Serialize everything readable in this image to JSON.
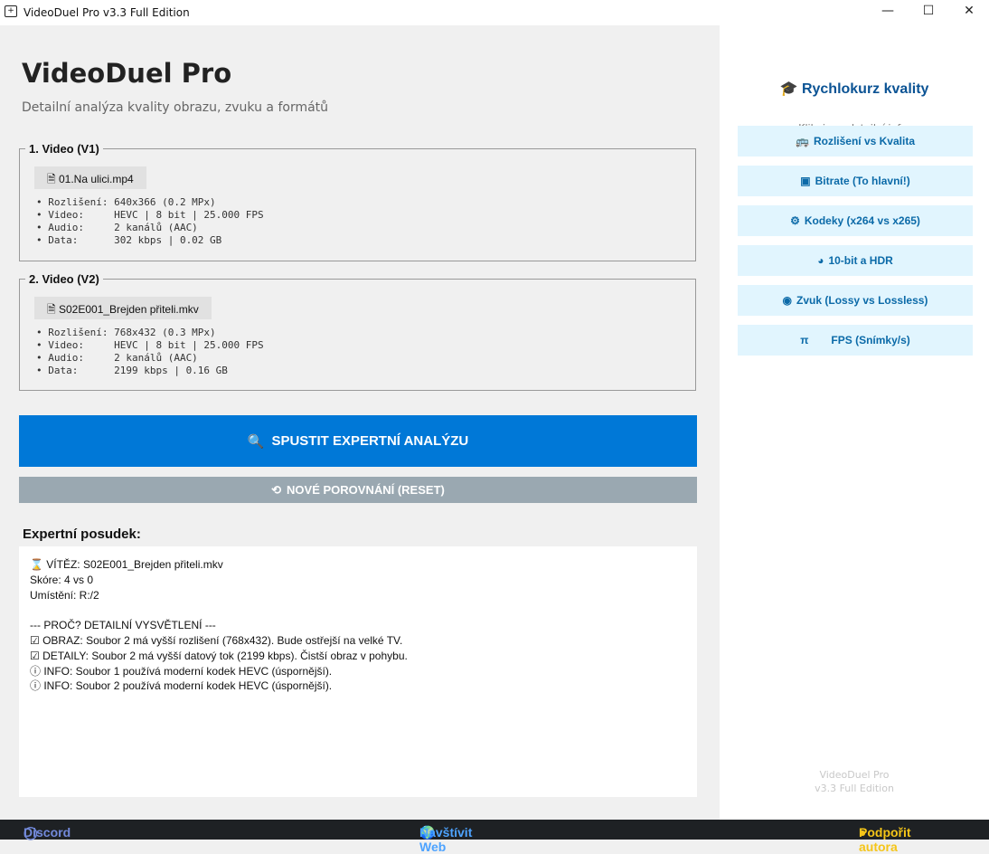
{
  "window": {
    "title": "VideoDuel Pro v3.3 Full Edition",
    "minimize": "—",
    "maximize": "☐",
    "close": "✕"
  },
  "header": {
    "title": "VideoDuel Pro",
    "subtitle": "Detailní analýza kvality obrazu, zvuku a formátů"
  },
  "videos": [
    {
      "legend": "1. Video (V1)",
      "file": "01.Na ulici.mp4",
      "info": "• Rozlišení: 640x366 (0.2 MPx)\n• Video:     HEVC | 8 bit | 25.000 FPS\n• Audio:     2 kanálů (AAC)\n• Data:      302 kbps | 0.02 GB"
    },
    {
      "legend": "2. Video (V2)",
      "file": "S02E001_Brejden přiteli.mkv",
      "info": "• Rozlišení: 768x432 (0.3 MPx)\n• Video:     HEVC | 8 bit | 25.000 FPS\n• Audio:     2 kanálů (AAC)\n• Data:      2199 kbps | 0.16 GB"
    }
  ],
  "buttons": {
    "analyze": "SPUSTIT EXPERTNÍ ANALÝZU",
    "reset": "NOVÉ POROVNÁNÍ (RESET)"
  },
  "result": {
    "heading": "Expertní posudek:",
    "lines": [
      "⌛ VÍTĚZ: S02E001_Brejden přiteli.mkv",
      "Skóre: 4 vs 0",
      "Umístění: R:/2",
      "",
      "--- PROČ? DETAILNÍ VYSVĚTLENÍ ---",
      "☑ OBRAZ: Soubor 2 má vyšší rozlišení (768x432). Bude ostřejší na velké TV.",
      "☑ DETAILY: Soubor 2 má vyšší datový tok (2199 kbps). Čistší obraz v pohybu.",
      "ⓘ INFO: Soubor 1 používá moderní kodek HEVC (úspornější).",
      "ⓘ INFO: Soubor 2 používá moderní kodek HEVC (úspornější)."
    ]
  },
  "sidebar": {
    "title": "Rychlokurz kvality",
    "hint": "Klikni pro detailní info:",
    "items": [
      {
        "icon": "🚌",
        "label": "Rozlišení vs Kvalita"
      },
      {
        "icon": "▣",
        "label": "Bitrate (To hlavní!)"
      },
      {
        "icon": "⚙",
        "label": "Kodeky (x264 vs x265)"
      },
      {
        "icon": "◕",
        "label": "10-bit a HDR"
      },
      {
        "icon": "◉",
        "label": "Zvuk (Lossy vs Lossless)"
      },
      {
        "icon": "π",
        "label": "FPS (Snímky/s)"
      }
    ],
    "version_name": "VideoDuel Pro",
    "version": "v3.3 Full Edition"
  },
  "footer": {
    "discord": "Discord",
    "web": "Navštívit Web",
    "support": "Podpořit autora"
  },
  "colors": {
    "accent": "#0078d7",
    "reset": "#9aa8b1",
    "footer": "#1e2124",
    "discord": "#7289da",
    "web": "#4da3ff",
    "support": "#f5c518"
  }
}
